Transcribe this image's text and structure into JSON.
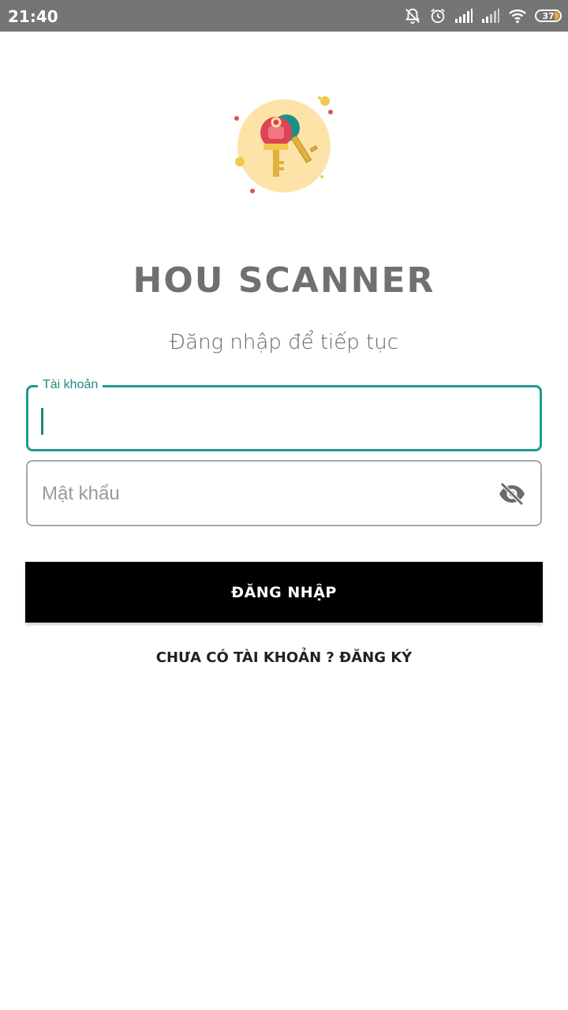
{
  "status_bar": {
    "time": "21:40",
    "battery": "37",
    "icons": [
      "bell-off-icon",
      "alarm-icon",
      "signal-icon",
      "signal-weak-icon",
      "wifi-icon",
      "battery-icon"
    ]
  },
  "app": {
    "title": "HOU SCANNER",
    "subtitle": "Đăng nhập để tiếp tục",
    "logo_icon": "keys-icon"
  },
  "form": {
    "username": {
      "label": "Tài khoản",
      "value": ""
    },
    "password": {
      "placeholder": "Mật khẩu",
      "value": "",
      "toggle_icon": "eye-off-icon"
    },
    "login_button": "ĐĂNG NHẬP",
    "register_link": "CHƯA CÓ TÀI KHOẢN ? ĐĂNG KÝ"
  },
  "colors": {
    "accent": "#1f9b8f",
    "status_bar": "#757575",
    "button": "#000000",
    "logo_circle": "#fde3a7"
  }
}
